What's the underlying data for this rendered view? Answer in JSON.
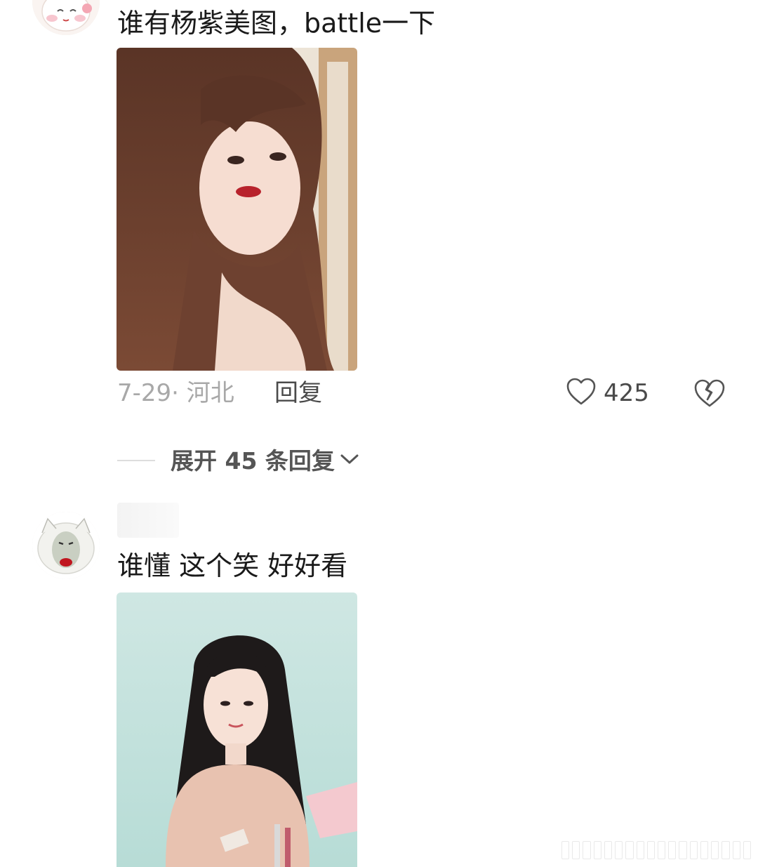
{
  "comments": [
    {
      "text": "谁有杨紫美图，battle一下",
      "date": "7-29",
      "separator": "·",
      "location": "河北",
      "reply_label": "回复",
      "likes": "425",
      "expand_label": "展开 45 条回复"
    },
    {
      "text": "谁懂  这个笑  好好看"
    }
  ],
  "icons": {
    "like": "heart-outline-icon",
    "dislike": "broken-heart-icon",
    "expand": "chevron-down-icon"
  }
}
